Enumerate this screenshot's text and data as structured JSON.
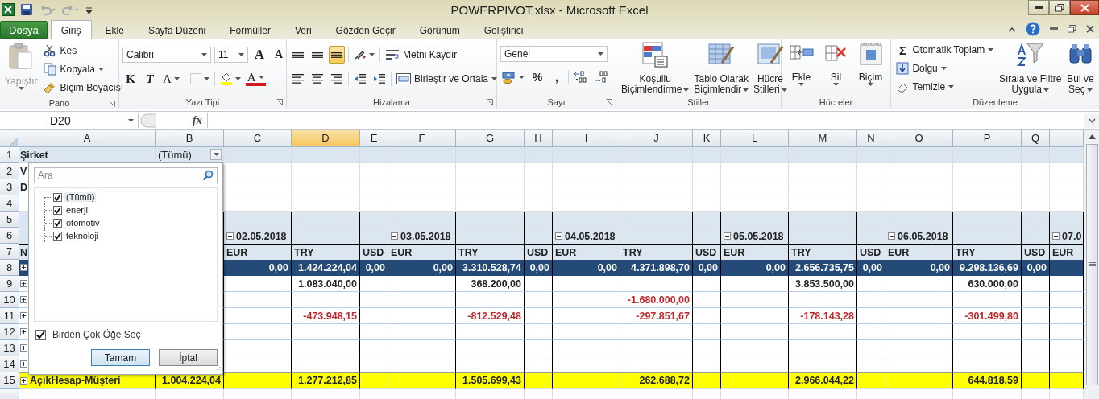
{
  "window": {
    "title": "POWERPIVOT.xlsx  -  Microsoft Excel"
  },
  "tabs": [
    {
      "label": "Dosya",
      "kind": "file",
      "selected": false
    },
    {
      "label": "Giriş",
      "kind": "tab",
      "selected": true
    },
    {
      "label": "Ekle",
      "kind": "tab",
      "selected": false
    },
    {
      "label": "Sayfa Düzeni",
      "kind": "tab",
      "selected": false
    },
    {
      "label": "Formüller",
      "kind": "tab",
      "selected": false
    },
    {
      "label": "Veri",
      "kind": "tab",
      "selected": false
    },
    {
      "label": "Gözden Geçir",
      "kind": "tab",
      "selected": false
    },
    {
      "label": "Görünüm",
      "kind": "tab",
      "selected": false
    },
    {
      "label": "Geliştirici",
      "kind": "tab",
      "selected": false
    }
  ],
  "ribbon": {
    "clipboard": {
      "label": "Pano",
      "paste": {
        "label": "Yapıştır",
        "disabled": true
      },
      "cut": "Kes",
      "copy": "Kopyala",
      "painter": "Biçim Boyacısı"
    },
    "font": {
      "label": "Yazı Tipi",
      "family": "Calibri",
      "size": "11",
      "grow": "A",
      "shrink": "A",
      "bold": "K",
      "italic": "T",
      "underline": "A",
      "font_color": "A"
    },
    "alignment": {
      "label": "Hizalama",
      "vertical": [
        {
          "selected": false
        },
        {
          "selected": false
        },
        {
          "selected": true
        }
      ],
      "wrap": "Metni Kaydır",
      "merge": "Birleştir ve Ortala"
    },
    "number": {
      "label": "Sayı",
      "format": "Genel",
      "percent": "%",
      "comma": ","
    },
    "styles": {
      "label": "Stiller",
      "buttons": [
        {
          "line1": "Koşullu",
          "line2": "Biçimlendirme"
        },
        {
          "line1": "Tablo Olarak",
          "line2": "Biçimlendir"
        },
        {
          "line1": "Hücre",
          "line2": "Stilleri"
        }
      ]
    },
    "cells": {
      "label": "Hücreler",
      "buttons": [
        "Ekle",
        "Sil",
        "Biçim"
      ]
    },
    "editing": {
      "label": "Düzenleme",
      "autosum_symbol": "Σ",
      "autosum": "Otomatik Toplam",
      "fill": "Dolgu",
      "clear": "Temizle",
      "sort": {
        "line1": "Sırala ve Filtre",
        "line2": "Uygula"
      },
      "find": {
        "line1": "Bul ve",
        "line2": "Seç"
      }
    }
  },
  "formula_bar": {
    "name_box": "D20",
    "function_label": "fx"
  },
  "sheet": {
    "columns": [
      {
        "letter": "A",
        "selected": false
      },
      {
        "letter": "B",
        "selected": false
      },
      {
        "letter": "C",
        "selected": false
      },
      {
        "letter": "D",
        "selected": true
      },
      {
        "letter": "E",
        "selected": false
      },
      {
        "letter": "F",
        "selected": false
      },
      {
        "letter": "G",
        "selected": false
      },
      {
        "letter": "H",
        "selected": false
      },
      {
        "letter": "I",
        "selected": false
      },
      {
        "letter": "J",
        "selected": false
      },
      {
        "letter": "K",
        "selected": false
      },
      {
        "letter": "L",
        "selected": false
      },
      {
        "letter": "M",
        "selected": false
      },
      {
        "letter": "N",
        "selected": false
      },
      {
        "letter": "O",
        "selected": false
      },
      {
        "letter": "P",
        "selected": false
      },
      {
        "letter": "Q",
        "selected": false
      },
      {
        "selected": false
      }
    ],
    "rows": [
      {
        "number": "1",
        "kind": "filter",
        "cells": [
          {
            "kind": "label",
            "text": "Şirket"
          },
          {
            "kind": "filter",
            "text": "(Tümü)"
          },
          null,
          null,
          null,
          null,
          null,
          null,
          null,
          null,
          null,
          null,
          null,
          null,
          null,
          null,
          null,
          null
        ]
      },
      {
        "number": "2",
        "kind": "plain",
        "cells": [
          {
            "kind": "label",
            "text": "V"
          },
          null,
          null,
          null,
          null,
          null,
          null,
          null,
          null,
          null,
          null,
          null,
          null,
          null,
          null,
          null,
          null,
          null
        ]
      },
      {
        "number": "3",
        "kind": "plain",
        "cells": [
          {
            "kind": "label",
            "text": "D"
          },
          null,
          null,
          null,
          null,
          null,
          null,
          null,
          null,
          null,
          null,
          null,
          null,
          null,
          null,
          null,
          null,
          null
        ]
      },
      {
        "number": "4",
        "kind": "plain",
        "cells": [
          null,
          null,
          null,
          null,
          null,
          null,
          null,
          null,
          null,
          null,
          null,
          null,
          null,
          null,
          null,
          null,
          null,
          null
        ]
      },
      {
        "number": "5",
        "kind": "band",
        "cells": [
          null,
          null,
          null,
          null,
          null,
          null,
          null,
          null,
          null,
          null,
          null,
          null,
          null,
          null,
          null,
          null,
          null,
          null
        ]
      },
      {
        "number": "6",
        "kind": "band",
        "cells": [
          null,
          null,
          {
            "kind": "date",
            "text": "02.05.2018"
          },
          null,
          null,
          {
            "kind": "date",
            "text": "03.05.2018"
          },
          null,
          null,
          {
            "kind": "date",
            "text": "04.05.2018"
          },
          null,
          null,
          {
            "kind": "date",
            "text": "05.05.2018"
          },
          null,
          null,
          {
            "kind": "date",
            "text": "06.05.2018"
          },
          null,
          null,
          {
            "kind": "date",
            "text": "07.0"
          }
        ]
      },
      {
        "number": "7",
        "kind": "band",
        "cells": [
          {
            "kind": "label",
            "text": "N"
          },
          null,
          {
            "kind": "label",
            "text": "EUR"
          },
          {
            "kind": "label",
            "text": "TRY"
          },
          {
            "kind": "label",
            "text": "USD"
          },
          {
            "kind": "label",
            "text": "EUR"
          },
          {
            "kind": "label",
            "text": "TRY"
          },
          {
            "kind": "label",
            "text": "USD"
          },
          {
            "kind": "label",
            "text": "EUR"
          },
          {
            "kind": "label",
            "text": "TRY"
          },
          {
            "kind": "label",
            "text": "USD"
          },
          {
            "kind": "label",
            "text": "EUR"
          },
          {
            "kind": "label",
            "text": "TRY"
          },
          {
            "kind": "label",
            "text": "USD"
          },
          {
            "kind": "label",
            "text": "EUR"
          },
          {
            "kind": "label",
            "text": "TRY"
          },
          {
            "kind": "label",
            "text": "USD"
          },
          {
            "kind": "label",
            "text": "EUR"
          }
        ]
      },
      {
        "number": "8",
        "kind": "total",
        "cells": [
          {
            "kind": "label",
            "expander": true
          },
          null,
          {
            "kind": "number",
            "text": "0,00"
          },
          {
            "kind": "number",
            "text": "1.424.224,04"
          },
          {
            "kind": "number",
            "text": "0,00"
          },
          {
            "kind": "number",
            "text": "0,00"
          },
          {
            "kind": "number",
            "text": "3.310.528,74"
          },
          {
            "kind": "number",
            "text": "0,00"
          },
          {
            "kind": "number",
            "text": "0,00"
          },
          {
            "kind": "number",
            "text": "4.371.898,70"
          },
          {
            "kind": "number",
            "text": "0,00"
          },
          {
            "kind": "number",
            "text": "0,00"
          },
          {
            "kind": "number",
            "text": "2.656.735,75"
          },
          {
            "kind": "number",
            "text": "0,00"
          },
          {
            "kind": "number",
            "text": "0,00"
          },
          {
            "kind": "number",
            "text": "9.298.136,69"
          },
          {
            "kind": "number",
            "text": "0,00"
          },
          null
        ]
      },
      {
        "number": "9",
        "kind": "data",
        "cells": [
          {
            "kind": "label",
            "expander": true
          },
          null,
          null,
          {
            "kind": "number",
            "text": "1.083.040,00"
          },
          null,
          null,
          {
            "kind": "number",
            "text": "368.200,00"
          },
          null,
          null,
          null,
          null,
          null,
          {
            "kind": "number",
            "text": "3.853.500,00"
          },
          null,
          null,
          {
            "kind": "number",
            "text": "630.000,00"
          },
          null,
          null
        ]
      },
      {
        "number": "10",
        "kind": "data",
        "cells": [
          {
            "kind": "label",
            "expander": true
          },
          null,
          null,
          null,
          null,
          null,
          null,
          null,
          null,
          {
            "kind": "negative",
            "text": "-1.680.000,00"
          },
          null,
          null,
          null,
          null,
          null,
          null,
          null,
          null
        ]
      },
      {
        "number": "11",
        "kind": "data",
        "cells": [
          {
            "kind": "label",
            "expander": true
          },
          null,
          null,
          {
            "kind": "negative",
            "text": "-473.948,15"
          },
          null,
          null,
          {
            "kind": "negative",
            "text": "-812.529,48"
          },
          null,
          null,
          {
            "kind": "negative",
            "text": "-297.851,67"
          },
          null,
          null,
          {
            "kind": "negative",
            "text": "-178.143,28"
          },
          null,
          null,
          {
            "kind": "negative",
            "text": "-301.499,80"
          },
          null,
          null
        ]
      },
      {
        "number": "12",
        "kind": "data",
        "cells": [
          {
            "kind": "label",
            "expander": true
          },
          null,
          null,
          null,
          null,
          null,
          null,
          null,
          null,
          null,
          null,
          null,
          null,
          null,
          null,
          null,
          null,
          null
        ]
      },
      {
        "number": "13",
        "kind": "data",
        "cells": [
          {
            "kind": "label",
            "expander": true
          },
          null,
          null,
          null,
          null,
          null,
          null,
          null,
          null,
          null,
          null,
          null,
          null,
          null,
          null,
          null,
          null,
          null
        ]
      },
      {
        "number": "14",
        "kind": "data",
        "cells": [
          {
            "kind": "label",
            "expander": true
          },
          null,
          null,
          null,
          null,
          null,
          null,
          null,
          null,
          null,
          null,
          null,
          null,
          null,
          null,
          null,
          null,
          null
        ]
      },
      {
        "number": "15",
        "kind": "grand",
        "cells": [
          {
            "kind": "label",
            "text": "AçıkHesap-Müşteri",
            "expander": true
          },
          {
            "kind": "number",
            "text": "1.004.224,04"
          },
          null,
          {
            "kind": "number",
            "text": "1.277.212,85"
          },
          null,
          null,
          {
            "kind": "number",
            "text": "1.505.699,43"
          },
          null,
          null,
          {
            "kind": "number",
            "text": "262.688,72"
          },
          null,
          null,
          {
            "kind": "number",
            "text": "2.966.044,22"
          },
          null,
          null,
          {
            "kind": "number",
            "text": "644.818,59"
          },
          null,
          null
        ]
      },
      {
        "kind": "plain",
        "cells": [
          null,
          null,
          null,
          null,
          null,
          null,
          null,
          null,
          null,
          null,
          null,
          null,
          null,
          null,
          null,
          null,
          null,
          null
        ]
      }
    ]
  },
  "filter_popup": {
    "search": {
      "placeholder": "Ara"
    },
    "items": [
      {
        "label": "(Tümü)",
        "checked": true,
        "selected": true
      },
      {
        "label": "enerji",
        "checked": true,
        "selected": false
      },
      {
        "label": "otomotiv",
        "checked": true,
        "selected": false
      },
      {
        "label": "teknoloji",
        "checked": true,
        "selected": false
      }
    ],
    "multi_select": {
      "label": "Birden Çok Öğe Seç",
      "checked": true
    },
    "buttons": [
      {
        "label": "Tamam",
        "default": true
      },
      {
        "label": "İptal",
        "default": false
      }
    ]
  }
}
